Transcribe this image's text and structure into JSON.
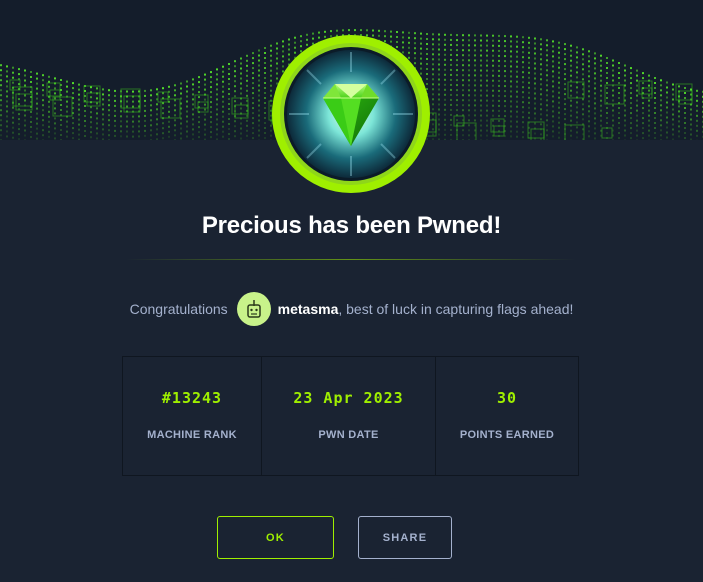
{
  "title": "Precious has been Pwned!",
  "congrats": {
    "prefix": "Congratulations",
    "username": "metasma",
    "suffix": ", best of luck in capturing flags ahead!"
  },
  "stats": [
    {
      "value": "#13243",
      "label": "MACHINE RANK"
    },
    {
      "value": "23 Apr 2023",
      "label": "PWN DATE"
    },
    {
      "value": "30",
      "label": "POINTS EARNED"
    }
  ],
  "buttons": {
    "ok": "OK",
    "share": "SHARE"
  },
  "colors": {
    "accent": "#9fef00",
    "background": "#1a2332",
    "text_muted": "#a4b1cd",
    "avatar_bg": "#c8f28a"
  },
  "icons": {
    "badge": "emerald-gem-icon",
    "avatar": "user-avatar-icon"
  }
}
